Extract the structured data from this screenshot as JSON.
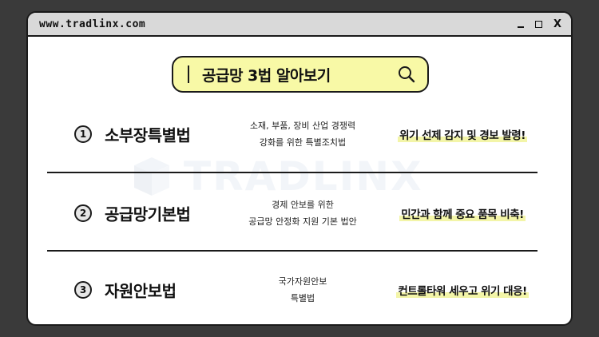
{
  "window": {
    "url": "www.tradlinx.com",
    "controls": {
      "minimize": "_",
      "maximize": "□",
      "close": "X"
    }
  },
  "watermark": {
    "text": "TRADLINX"
  },
  "search": {
    "text": "공급망 3법 알아보기",
    "icon": "search-icon"
  },
  "rows": [
    {
      "num": "1",
      "law": "소부장특별법",
      "desc_line1": "소재, 부품, 장비 산업 경쟁력",
      "desc_line2": "강화를 위한 특별조치법",
      "note": "위기 선제 감지 및 경보 발령!"
    },
    {
      "num": "2",
      "law": "공급망기본법",
      "desc_line1": "경제 안보를 위한",
      "desc_line2": "공급망 안정화 지원 기본 법안",
      "note": "민간과 함께 중요 품목 비축!"
    },
    {
      "num": "3",
      "law": "자원안보법",
      "desc_line1": "국가자원안보",
      "desc_line2": "특별법",
      "note": "컨트롤타워 세우고 위기 대응!"
    }
  ],
  "colors": {
    "highlight": "#f8f9a6",
    "titlebar": "#d9d9d9",
    "border": "#1a1a1a"
  }
}
